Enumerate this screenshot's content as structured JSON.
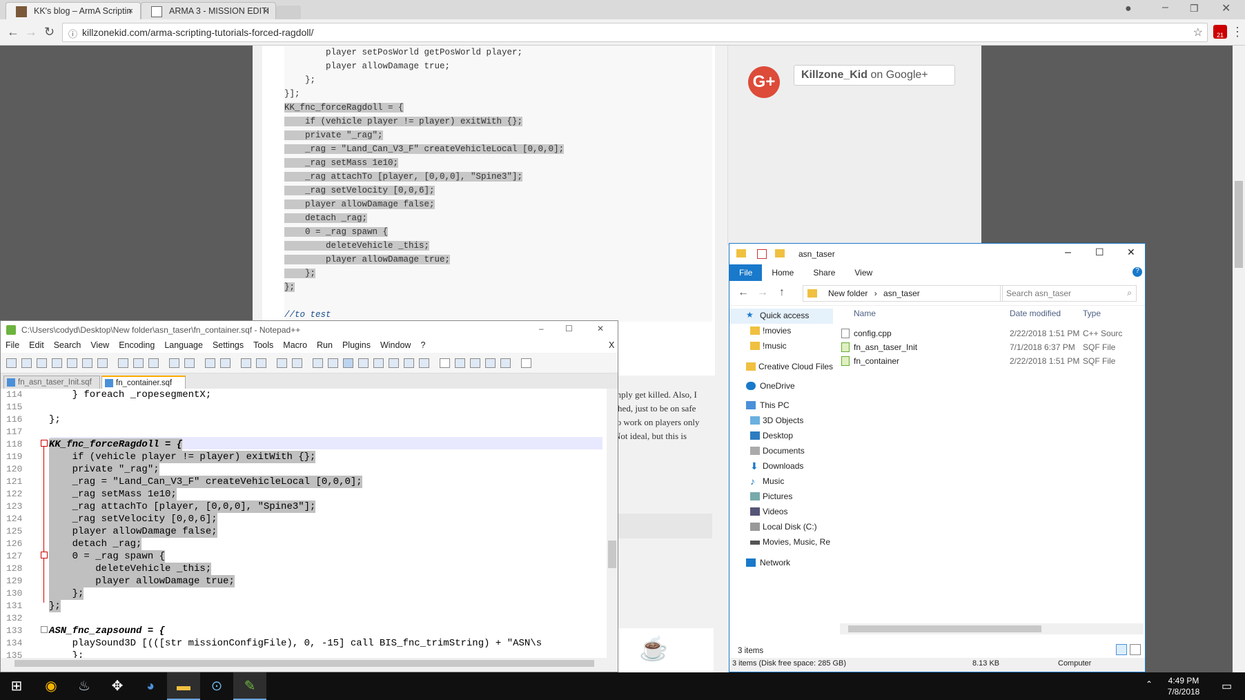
{
  "browser": {
    "tabs": [
      {
        "title": "KK's blog – ArmA Scriptin",
        "close": "×"
      },
      {
        "title": "ARMA 3 - MISSION EDITI",
        "close": "×"
      }
    ],
    "url": "killzonekid.com/arma-scripting-tutorials-forced-ragdoll/",
    "extension_badge": "21"
  },
  "page": {
    "code_lines": [
      "        player setPosWorld getPosWorld player;",
      "        player allowDamage true;",
      "    };",
      "}];",
      "KK_fnc_forceRagdoll = {",
      "    if (vehicle player != player) exitWith {};",
      "    private \"_rag\";",
      "    _rag = \"Land_Can_V3_F\" createVehicleLocal [0,0,0];",
      "    _rag setMass 1e10;",
      "    _rag attachTo [player, [0,0,0], \"Spine3\"];",
      "    _rag setVelocity [0,0,6];",
      "    player allowDamage false;",
      "    detach _rag;",
      "    0 = _rag spawn {",
      "        deleteVehicle _this;",
      "        player allowDamage true;",
      "    };",
      "};",
      "",
      "//to test"
    ],
    "article_lines": [
      "mply get killed. Also, I",
      "shed, just to be on safe",
      "to work on players only",
      "Not ideal, but this is"
    ],
    "gplus_label": "Killzone_Kid",
    "gplus_suffix": " on Google+",
    "gplus_icon": "G+"
  },
  "notepad": {
    "title": "C:\\Users\\codyd\\Desktop\\New folder\\asn_taser\\fn_container.sqf - Notepad++",
    "menu": [
      "File",
      "Edit",
      "Search",
      "View",
      "Encoding",
      "Language",
      "Settings",
      "Tools",
      "Macro",
      "Run",
      "Plugins",
      "Window",
      "?"
    ],
    "close_x": "X",
    "tabs": [
      "fn_asn_taser_Init.sqf",
      "fn_container.sqf"
    ],
    "lines": [
      {
        "n": "114",
        "t": "    } foreach _ropesegmentX;"
      },
      {
        "n": "115",
        "t": ""
      },
      {
        "n": "116",
        "t": "};"
      },
      {
        "n": "117",
        "t": ""
      },
      {
        "n": "118",
        "t": "KK_fnc_forceRagdoll = {"
      },
      {
        "n": "119",
        "t": "    if (vehicle player != player) exitWith {};"
      },
      {
        "n": "120",
        "t": "    private \"_rag\";"
      },
      {
        "n": "121",
        "t": "    _rag = \"Land_Can_V3_F\" createVehicleLocal [0,0,0];"
      },
      {
        "n": "122",
        "t": "    _rag setMass 1e10;"
      },
      {
        "n": "123",
        "t": "    _rag attachTo [player, [0,0,0], \"Spine3\"];"
      },
      {
        "n": "124",
        "t": "    _rag setVelocity [0,0,6];"
      },
      {
        "n": "125",
        "t": "    player allowDamage false;"
      },
      {
        "n": "126",
        "t": "    detach _rag;"
      },
      {
        "n": "127",
        "t": "    0 = _rag spawn {"
      },
      {
        "n": "128",
        "t": "        deleteVehicle _this;"
      },
      {
        "n": "129",
        "t": "        player allowDamage true;"
      },
      {
        "n": "130",
        "t": "    };"
      },
      {
        "n": "131",
        "t": "};"
      },
      {
        "n": "132",
        "t": ""
      },
      {
        "n": "133",
        "t": "ASN_fnc_zapsound = {"
      },
      {
        "n": "134",
        "t": "    playSound3D [(([str missionConfigFile), 0, -15] call BIS_fnc_trimString) + \"ASN\\s"
      },
      {
        "n": "135",
        "t": "    };"
      }
    ]
  },
  "explorer": {
    "title": "asn_taser",
    "ribbon": [
      "File",
      "Home",
      "Share",
      "View"
    ],
    "path": [
      "New folder",
      "asn_taser"
    ],
    "search_placeholder": "Search asn_taser",
    "nav": [
      "Quick access",
      "!movies",
      "!music",
      "Creative Cloud Files",
      "OneDrive",
      "This PC",
      "3D Objects",
      "Desktop",
      "Documents",
      "Downloads",
      "Music",
      "Pictures",
      "Videos",
      "Local Disk (C:)",
      "Movies, Music, Re",
      "Network"
    ],
    "columns": [
      "Name",
      "Date modified",
      "Type"
    ],
    "files": [
      {
        "name": "config.cpp",
        "date": "2/22/2018 1:51 PM",
        "type": "C++ Sourc"
      },
      {
        "name": "fn_asn_taser_Init",
        "date": "7/1/2018 6:37 PM",
        "type": "SQF File"
      },
      {
        "name": "fn_container",
        "date": "2/22/2018 1:51 PM",
        "type": "SQF File"
      }
    ],
    "status": "3 items",
    "status_bar": "3 items (Disk free space: 285 GB)",
    "status_size": "8.13 KB",
    "status_loc": "Computer"
  },
  "taskbar": {
    "time": "4:49 PM",
    "date": "7/8/2018"
  }
}
